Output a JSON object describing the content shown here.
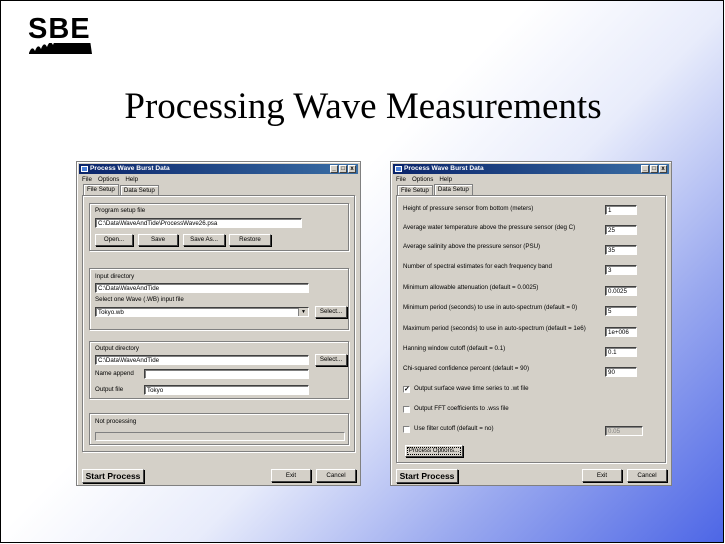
{
  "logo": {
    "text": "SBE"
  },
  "slide_title": "Processing Wave Measurements",
  "left_window": {
    "title": "Process Wave Burst Data",
    "menu": [
      "File",
      "Options",
      "Help"
    ],
    "tabs": [
      "File Setup",
      "Data Setup"
    ],
    "program_setup_label": "Program setup file",
    "program_setup_value": "C:\\Data\\WaveAndTide\\ProcessWave26.psa",
    "buttons": {
      "open": "Open...",
      "save": "Save",
      "save_as": "Save As...",
      "restore": "Restore",
      "select": "Select...",
      "start": "Start Process",
      "exit": "Exit",
      "cancel": "Cancel"
    },
    "input_dir_label": "Input directory",
    "input_dir_value": "C:\\Data\\WaveAndTide",
    "select_input_label": "Select one Wave (.WB) input file",
    "input_file_value": "Tokyo.wb",
    "output_dir_label": "Output directory",
    "output_dir_value": "C:\\Data\\WaveAndTide",
    "name_append_label": "Name append",
    "name_append_value": "",
    "output_file_label": "Output file",
    "output_file_value": "Tokyo",
    "status": "Not processing"
  },
  "right_window": {
    "title": "Process Wave Burst Data",
    "menu": [
      "File",
      "Options",
      "Help"
    ],
    "tabs": [
      "File Setup",
      "Data Setup"
    ],
    "params": [
      {
        "label": "Height of pressure sensor from bottom (meters)",
        "value": "1"
      },
      {
        "label": "Average water temperature above the pressure sensor (deg C)",
        "value": "25"
      },
      {
        "label": "Average salinity above the pressure sensor (PSU)",
        "value": "35"
      },
      {
        "label": "Number of spectral estimates for each frequency band",
        "value": "3"
      },
      {
        "label": "Minimum allowable attenuation (default = 0.0025)",
        "value": "0.0025"
      },
      {
        "label": "Minimum period (seconds) to use in auto-spectrum (default = 0)",
        "value": "5"
      },
      {
        "label": "Maximum period (seconds) to use in auto-spectrum (default = 1e6)",
        "value": "1e+006"
      },
      {
        "label": "Hanning window cutoff (default = 0.1)",
        "value": "0.1"
      },
      {
        "label": "Chi-squared confidence percent (default = 90)",
        "value": "90"
      }
    ],
    "checks": [
      {
        "label": "Output surface wave time series to .wt file",
        "checked": true
      },
      {
        "label": "Output FFT coefficients to .wss file",
        "checked": false
      },
      {
        "label": "Use filter cutoff (default = no)",
        "checked": false
      }
    ],
    "filter_value": "0.05",
    "process_options": "Process Options...",
    "start": "Start Process",
    "exit": "Exit",
    "cancel": "Cancel"
  }
}
